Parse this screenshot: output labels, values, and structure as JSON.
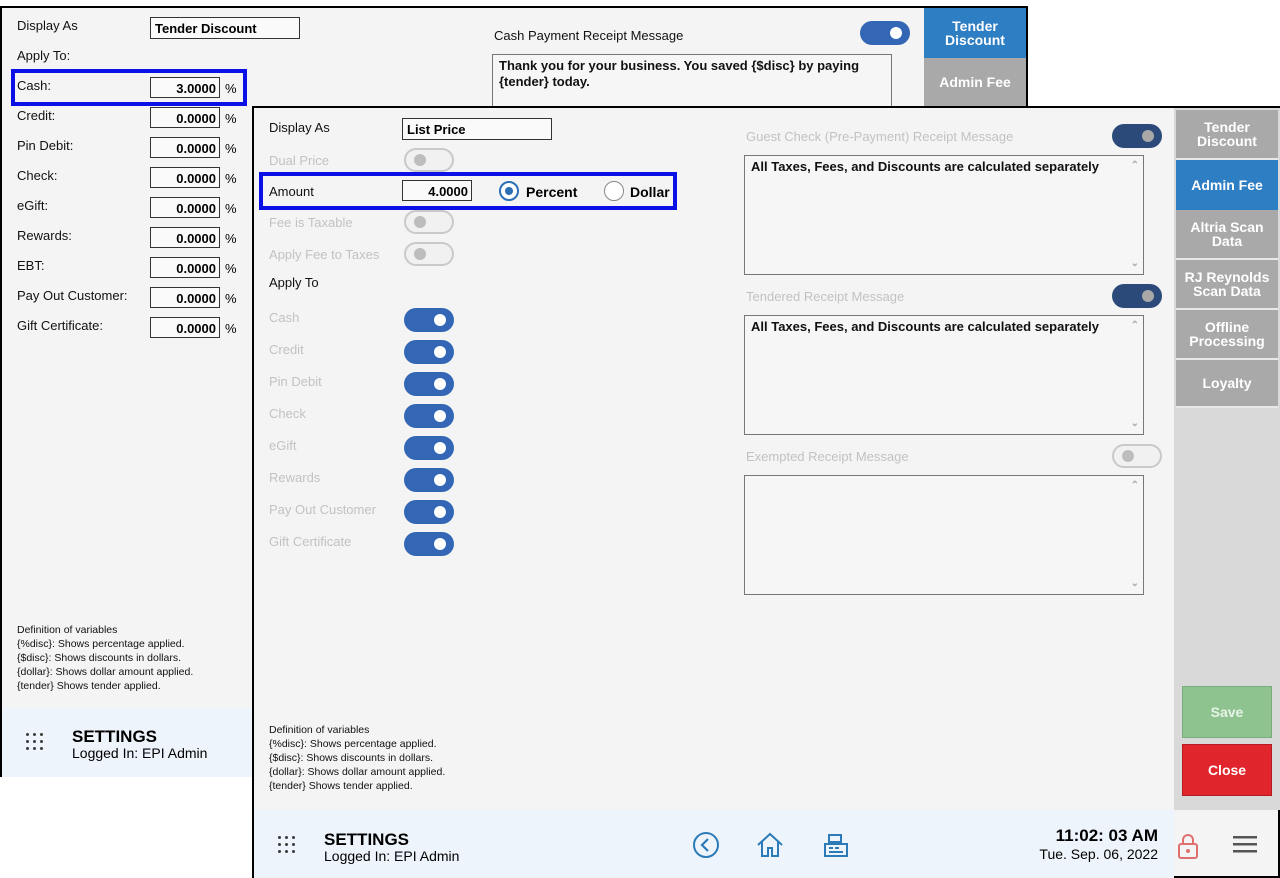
{
  "back_window": {
    "display_as_label": "Display As",
    "display_as_value": "Tender Discount",
    "apply_to_label": "Apply To:",
    "rows": [
      {
        "label": "Cash:",
        "value": "3.0000",
        "unit": "%"
      },
      {
        "label": "Credit:",
        "value": "0.0000",
        "unit": "%"
      },
      {
        "label": "Pin Debit:",
        "value": "0.0000",
        "unit": "%"
      },
      {
        "label": "Check:",
        "value": "0.0000",
        "unit": "%"
      },
      {
        "label": "eGift:",
        "value": "0.0000",
        "unit": "%"
      },
      {
        "label": "Rewards:",
        "value": "0.0000",
        "unit": "%"
      },
      {
        "label": "EBT:",
        "value": "0.0000",
        "unit": "%"
      },
      {
        "label": "Pay Out Customer:",
        "value": "0.0000",
        "unit": "%"
      },
      {
        "label": "Gift Certificate:",
        "value": "0.0000",
        "unit": "%"
      }
    ],
    "receipt_label": "Cash Payment Receipt Message",
    "receipt_text": "Thank you for your business. You saved {$disc} by paying {tender} today.",
    "tabs": [
      "Tender Discount",
      "Admin Fee"
    ],
    "vars": [
      "Definition of variables",
      "{%disc}: Shows percentage applied.",
      "{$disc}:  Shows discounts in dollars.",
      "{dollar}: Shows dollar amount applied.",
      "{tender} Shows tender applied."
    ],
    "footer_title": "SETTINGS",
    "footer_user": "Logged In:  EPI Admin"
  },
  "front_window": {
    "display_as_label": "Display As",
    "display_as_value": "List Price",
    "dual_price_label": "Dual Price",
    "amount_label": "Amount",
    "amount_value": "4.0000",
    "percent_label": "Percent",
    "dollar_label": "Dollar",
    "fee_taxable_label": "Fee is Taxable",
    "apply_fee_taxes_label": "Apply Fee to Taxes",
    "apply_to_label": "Apply To",
    "apply_items": [
      "Cash",
      "Credit",
      "Pin Debit",
      "Check",
      "eGift",
      "Rewards",
      "Pay Out Customer",
      "Gift Certificate"
    ],
    "guest_check_label": "Guest Check (Pre-Payment) Receipt Message",
    "guest_check_text": "All Taxes, Fees, and Discounts are calculated separately",
    "tendered_label": "Tendered Receipt Message",
    "tendered_text": "All Taxes, Fees, and Discounts are calculated separately",
    "exempted_label": "Exempted Receipt Message",
    "exempted_text": "",
    "tabs": [
      "Tender Discount",
      "Admin Fee",
      "Altria Scan Data",
      "RJ Reynolds Scan Data",
      "Offline Processing",
      "Loyalty"
    ],
    "save_label": "Save",
    "close_label": "Close",
    "vars": [
      "Definition of variables",
      "{%disc}: Shows percentage applied.",
      "{$disc}: Shows discounts in dollars.",
      "{dollar}: Shows dollar amount applied.",
      "{tender} Shows tender applied."
    ],
    "footer_title": "SETTINGS",
    "footer_user": "Logged In:  EPI Admin",
    "time": "11:02: 03 AM",
    "date": "Tue. Sep. 06, 2022"
  },
  "colors": {
    "highlight": "#0a10e6",
    "active_tab": "#2e7ec4",
    "toggle_on": "#3367b5",
    "save": "#8ec38f",
    "close": "#e0262c"
  }
}
